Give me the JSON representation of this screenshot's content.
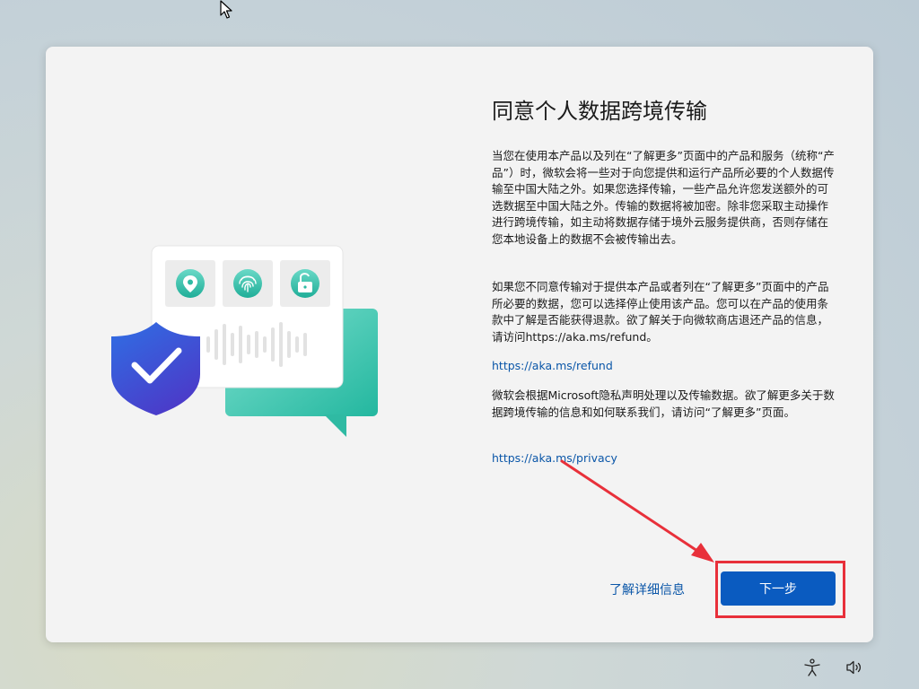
{
  "dialog": {
    "title": "同意个人数据跨境传输",
    "paragraph1": "当您在使用本产品以及列在“了解更多”页面中的产品和服务（统称“产品”）时，微软会将一些对于向您提供和运行产品所必要的个人数据传输至中国大陆之外。如果您选择传输，一些产品允许您发送额外的可选数据至中国大陆之外。传输的数据将被加密。除非您采取主动操作进行跨境传输，如主动将数据存储于境外云服务提供商，否则存储在您本地设备上的数据不会被传输出去。",
    "paragraph2": "如果您不同意传输对于提供本产品或者列在“了解更多”页面中的产品所必要的数据，您可以选择停止使用该产品。您可以在产品的使用条款中了解是否能获得退款。欲了解关于向微软商店退还产品的信息，请访问https://aka.ms/refund。",
    "link_refund": "https://aka.ms/refund",
    "paragraph3": "微软会根据Microsoft隐私声明处理以及传输数据。欲了解更多关于数据跨境传输的信息和如何联系我们，请访问“了解更多”页面。",
    "link_privacy": "https://aka.ms/privacy",
    "learn_more_label": "了解详细信息",
    "next_label": "下一步"
  },
  "illustration": {
    "icons": [
      "location-pin-icon",
      "fingerprint-icon",
      "unlock-icon",
      "shield-check-icon"
    ]
  },
  "taskbar": {
    "icons": [
      "accessibility-icon",
      "volume-icon"
    ]
  },
  "colors": {
    "accent": "#0a5bc0",
    "link": "#0a56a8",
    "annotation": "#e8303a",
    "teal": "#3cc4b0",
    "shield_blue": "#3a4fd6"
  }
}
